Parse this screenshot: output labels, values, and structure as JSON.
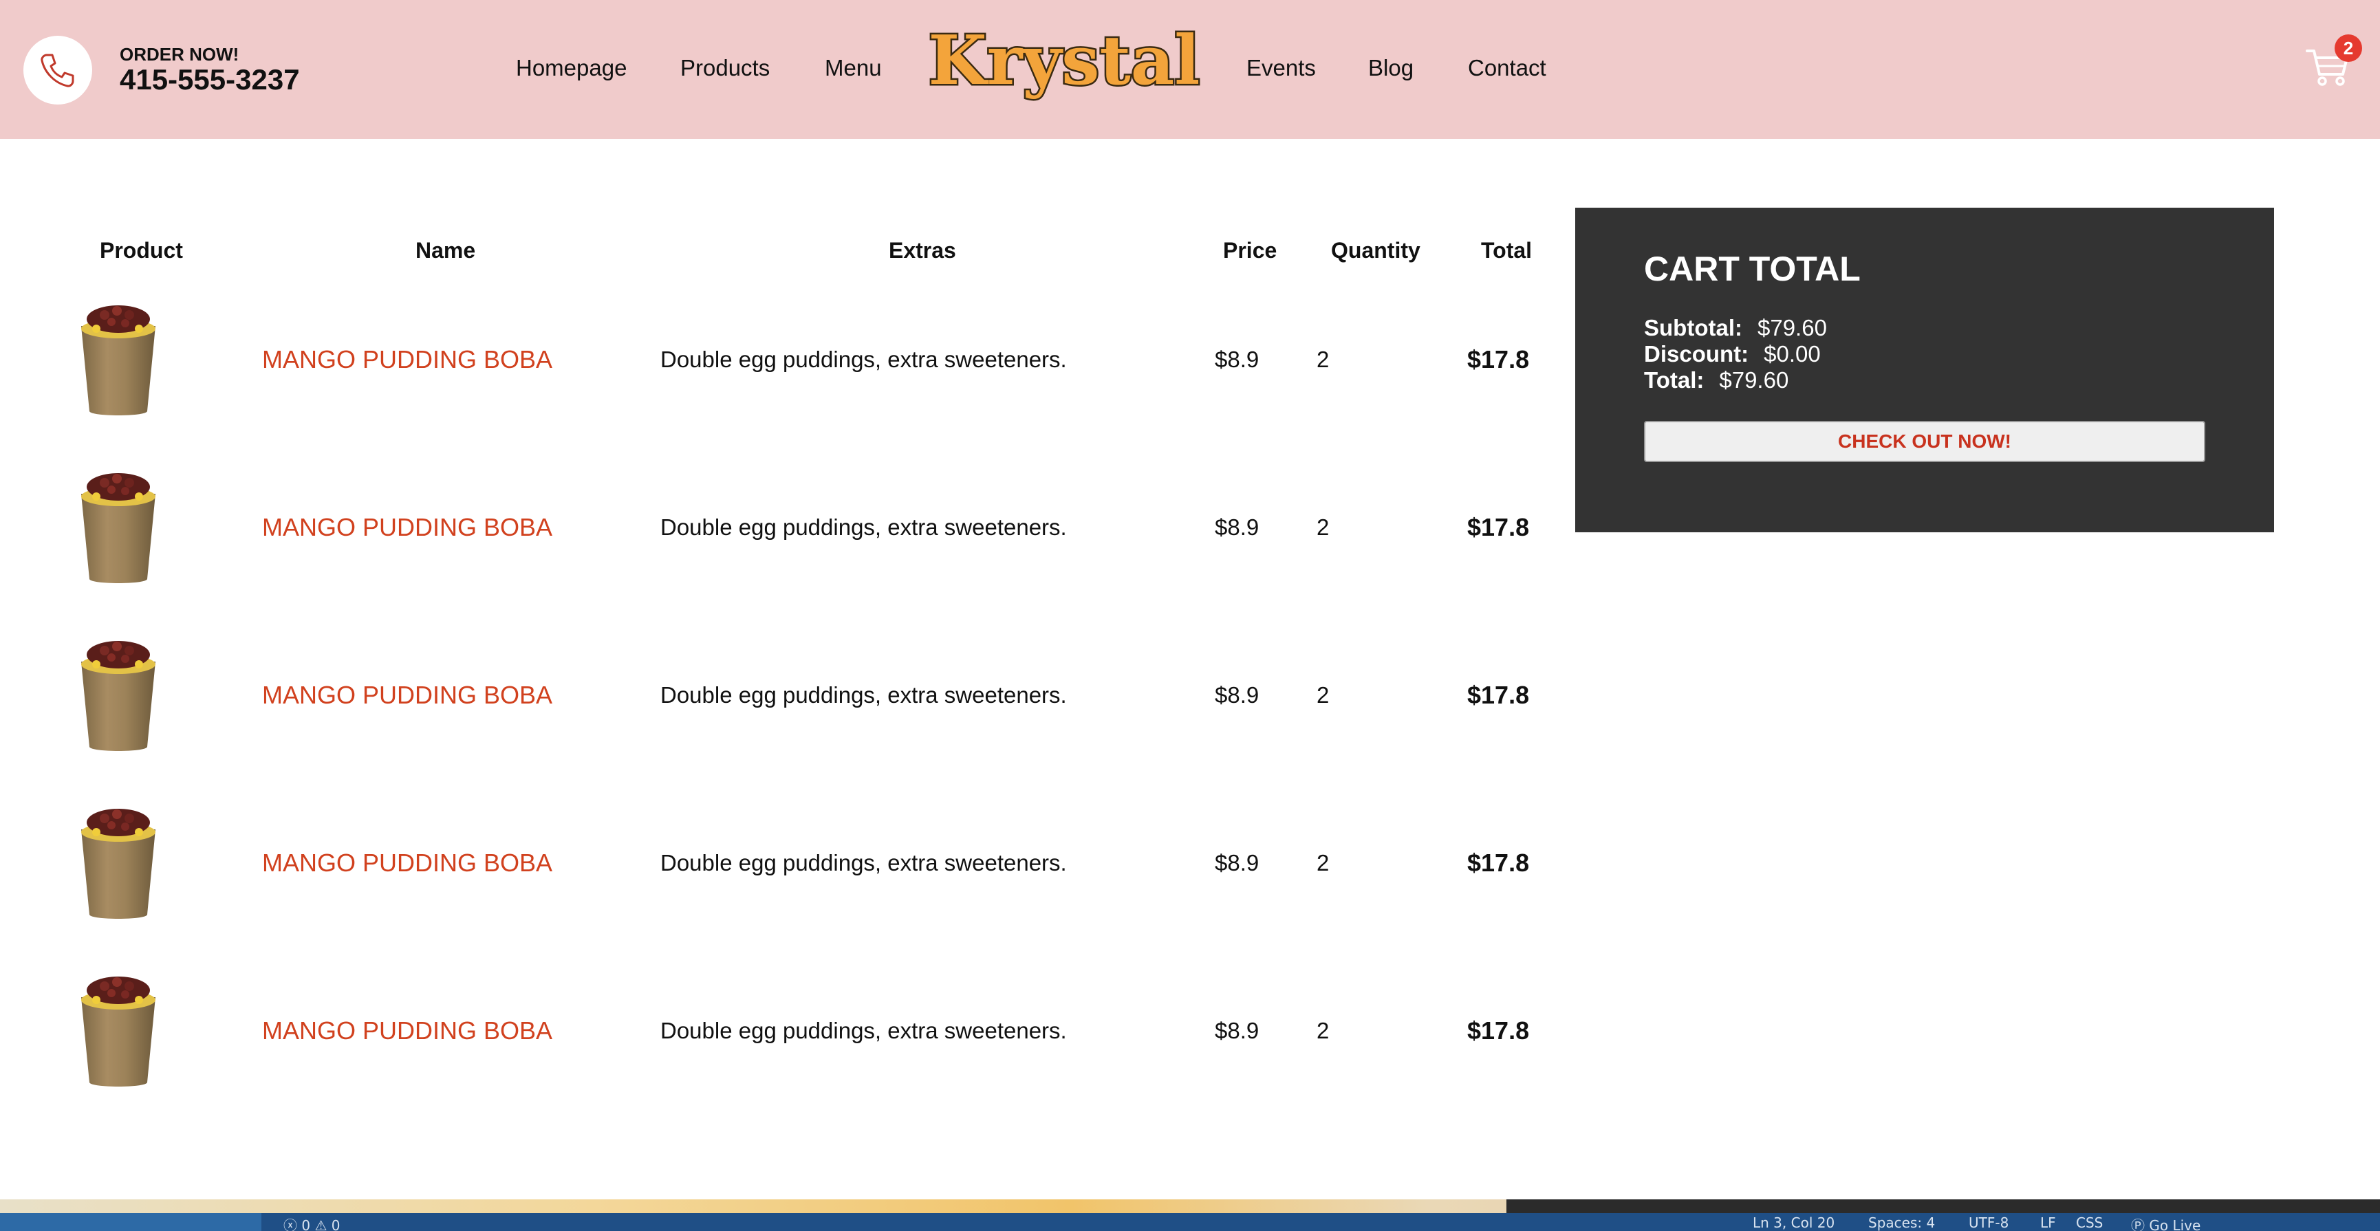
{
  "header": {
    "order_label": "ORDER NOW!",
    "phone": "415-555-3237",
    "nav": [
      "Homepage",
      "Products",
      "Menu",
      "Events",
      "Blog",
      "Contact"
    ],
    "logo_text": "Krystal",
    "cart_count": "2",
    "background": "#f0cbcb"
  },
  "table": {
    "headers": [
      "Product",
      "Name",
      "Extras",
      "Price",
      "Quantity",
      "Total"
    ],
    "rows": [
      {
        "image": "mango-pudding-boba-image",
        "name": "MANGO PUDDING BOBA",
        "extras": "Double egg puddings, extra sweeteners.",
        "price": "$8.9",
        "quantity": "2",
        "total": "$17.8"
      },
      {
        "image": "mango-pudding-boba-image",
        "name": "MANGO PUDDING BOBA",
        "extras": "Double egg puddings, extra sweeteners.",
        "price": "$8.9",
        "quantity": "2",
        "total": "$17.8"
      },
      {
        "image": "mango-pudding-boba-image",
        "name": "MANGO PUDDING BOBA",
        "extras": "Double egg puddings, extra sweeteners.",
        "price": "$8.9",
        "quantity": "2",
        "total": "$17.8"
      },
      {
        "image": "mango-pudding-boba-image",
        "name": "MANGO PUDDING BOBA",
        "extras": "Double egg puddings, extra sweeteners.",
        "price": "$8.9",
        "quantity": "2",
        "total": "$17.8"
      },
      {
        "image": "mango-pudding-boba-image",
        "name": "MANGO PUDDING BOBA",
        "extras": "Double egg puddings, extra sweeteners.",
        "price": "$8.9",
        "quantity": "2",
        "total": "$17.8"
      }
    ]
  },
  "cart_total": {
    "title": "CART TOTAL",
    "subtotal_label": "Subtotal:",
    "subtotal": "$79.60",
    "discount_label": "Discount:",
    "discount": "$0.00",
    "total_label": "Total:",
    "total": "$79.60",
    "checkout_label": "CHECK OUT NOW!"
  },
  "status_bar": {
    "problems": "ⓧ 0 ⚠ 0",
    "position": "Ln 3, Col 20",
    "spaces": "Spaces: 4",
    "encoding": "UTF-8",
    "eol": "LF",
    "language": "CSS",
    "golive": "Ⓟ Go Live"
  },
  "colors": {
    "accent": "#d1411e",
    "panel": "#333333",
    "badge": "#e53a2f"
  }
}
